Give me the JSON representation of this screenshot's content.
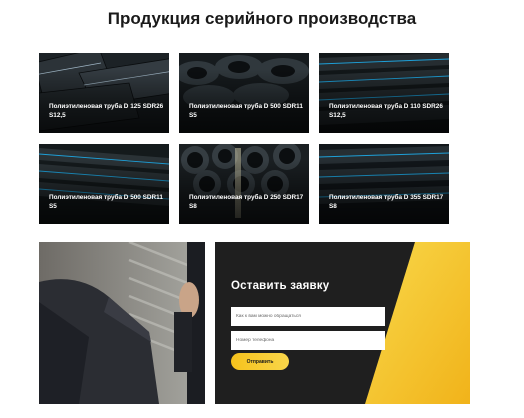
{
  "page": {
    "title": "Продукция серийного производства"
  },
  "products": [
    {
      "name": "Полиэтиленовая труба D 125 SDR26 S12,5",
      "stripe": "#9fb5c4"
    },
    {
      "name": "Полиэтиленовая труба D 500 SDR11 S5",
      "stripe": "#2a3134"
    },
    {
      "name": "Полиэтиленовая труба D 110 SDR26 S12,5",
      "stripe": "#1ea0d8"
    },
    {
      "name": "Полиэтиленовая труба D 500 SDR11 S5",
      "stripe": "#1ea0d8"
    },
    {
      "name": "Полиэтиленовая труба D 250 SDR17 S8",
      "stripe": "#2a3134"
    },
    {
      "name": "Полиэтиленовая труба D 355 SDR17 S8",
      "stripe": "#1ea0d8"
    }
  ],
  "form": {
    "title": "Оставить заявку",
    "name_placeholder": "Как к вам можно обращаться",
    "phone_placeholder": "Номер телефона",
    "submit_label": "Отправить"
  },
  "colors": {
    "accent": "#f6c21c",
    "panel": "#1f1f1f",
    "stripe_blue": "#1ea0d8"
  }
}
